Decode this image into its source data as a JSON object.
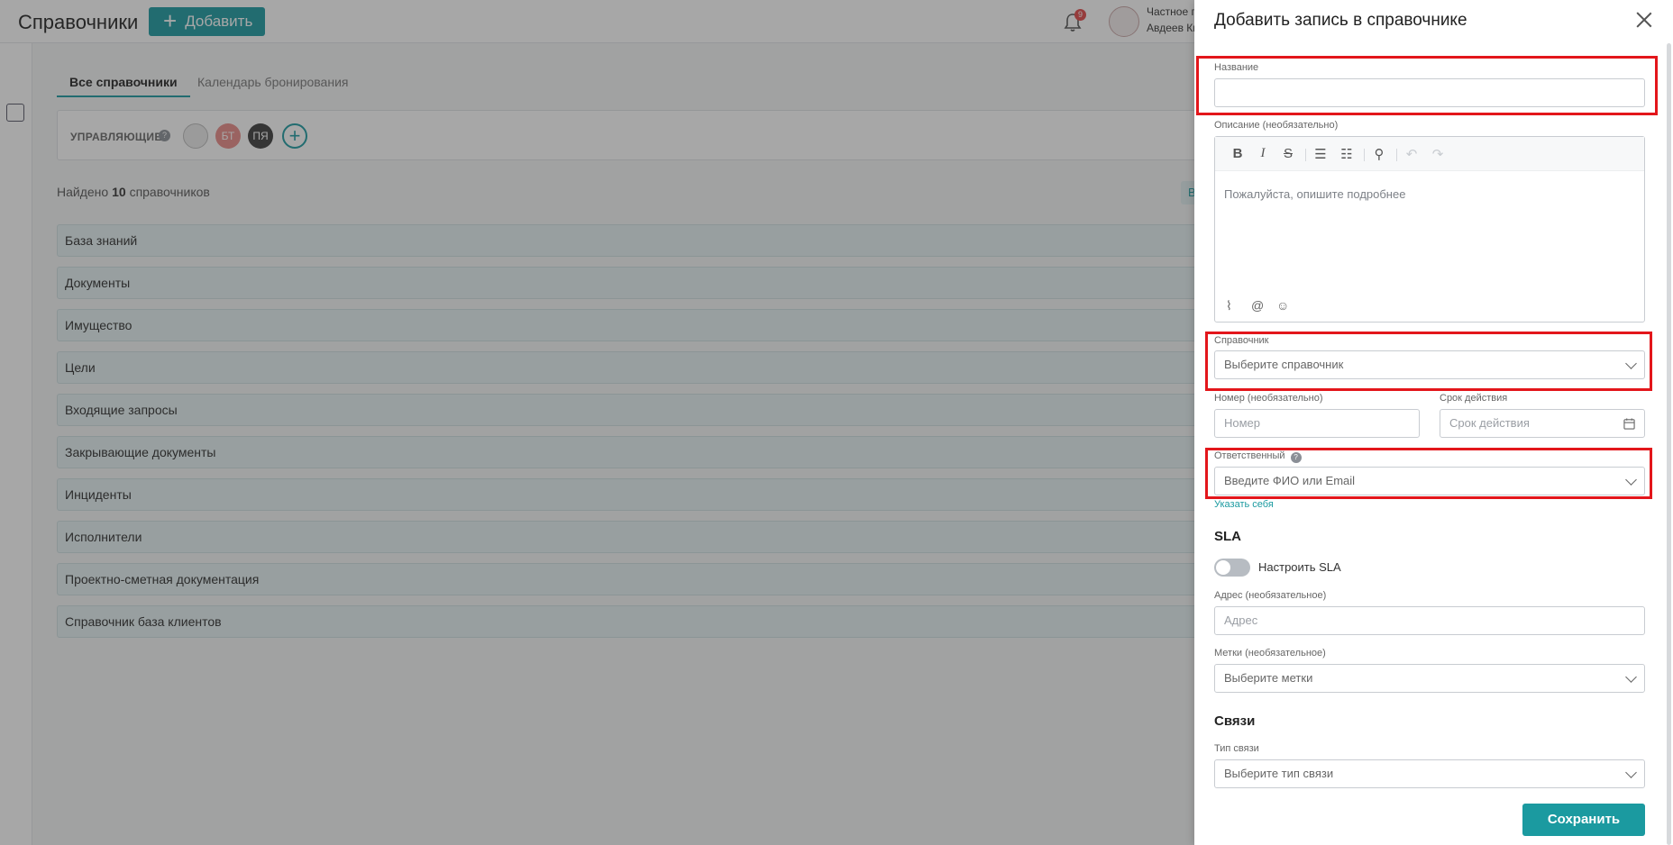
{
  "app": {
    "title": "Справочники",
    "add_label": "Добавить",
    "notifications_count": "9",
    "org_line1": "Частное п",
    "org_line2": "Авдеев Ки"
  },
  "tabs": [
    {
      "label": "Все справочники"
    },
    {
      "label": "Календарь бронирования"
    }
  ],
  "managers": {
    "label": "УПРАВЛЯЮЩИЕ",
    "help": "?",
    "avatars": [
      "",
      "БТ",
      "ПЯ"
    ]
  },
  "found": {
    "prefix": "Найдено",
    "count": "10",
    "suffix": "справочников"
  },
  "side_chip": "В",
  "directories": [
    "База знаний",
    "Документы",
    "Имущество",
    "Цели",
    "Входящие запросы",
    "Закрывающие документы",
    "Инциденты",
    "Исполнители",
    "Проектно-сметная документация",
    "Справочник база клиентов"
  ],
  "panel": {
    "title": "Добавить запись в справочнике",
    "name_label": "Название",
    "name_value": "",
    "description_label": "Описание (необязательно)",
    "description_placeholder": "Пожалуйста, опишите подробнее",
    "directory_label": "Справочник",
    "directory_placeholder": "Выберите справочник",
    "number_label": "Номер (необязательно)",
    "number_placeholder": "Номер",
    "term_label": "Срок действия",
    "term_placeholder": "Срок действия",
    "responsible_label": "Ответственный",
    "responsible_placeholder": "Введите ФИО или Email",
    "assign_self": "Указать себя",
    "sla_title": "SLA",
    "sla_toggle_label": "Настроить SLA",
    "address_label": "Адрес (необязательное)",
    "address_placeholder": "Адрес",
    "tags_label": "Метки (необязательное)",
    "tags_placeholder": "Выберите метки",
    "links_title": "Связи",
    "link_type_label": "Тип связи",
    "link_type_placeholder": "Выберите тип связи",
    "save_label": "Сохранить"
  },
  "toolbar_icons": [
    "bold-icon",
    "italic-icon",
    "strikethrough-icon",
    "bullet-list-icon",
    "numbered-list-icon",
    "link-icon",
    "undo-icon",
    "redo-icon"
  ],
  "colors": {
    "accent": "#1b9aa0",
    "highlight": "#e3161b",
    "badge": "#e24848"
  }
}
